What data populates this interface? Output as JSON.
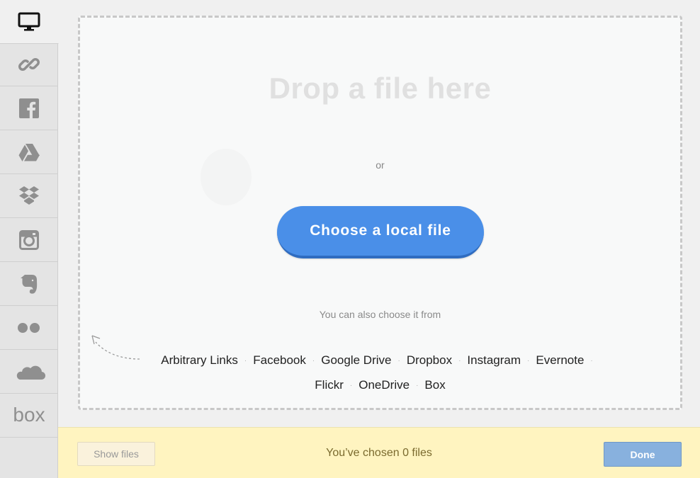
{
  "sidebar": {
    "items": [
      {
        "icon": "monitor-icon",
        "active": true
      },
      {
        "icon": "link-icon"
      },
      {
        "icon": "facebook-icon"
      },
      {
        "icon": "google-drive-icon"
      },
      {
        "icon": "dropbox-icon"
      },
      {
        "icon": "instagram-icon"
      },
      {
        "icon": "evernote-icon"
      },
      {
        "icon": "flickr-icon"
      },
      {
        "icon": "onedrive-icon"
      },
      {
        "icon": "box-icon",
        "label": "box"
      }
    ]
  },
  "dropzone": {
    "title": "Drop a file here",
    "or": "or",
    "choose_button": "Choose a local file",
    "also_text": "You can also choose it from",
    "sources_row1": [
      "Arbitrary Links",
      "Facebook",
      "Google Drive",
      "Dropbox",
      "Instagram",
      "Evernote"
    ],
    "sources_row2": [
      "Flickr",
      "OneDrive",
      "Box"
    ]
  },
  "footer": {
    "show_files": "Show files",
    "chosen_text": "You’ve chosen 0 files",
    "done": "Done"
  },
  "colors": {
    "accent": "#4a8fe8",
    "footer_bg": "#fff4c0",
    "done_bg": "#88b1de"
  }
}
